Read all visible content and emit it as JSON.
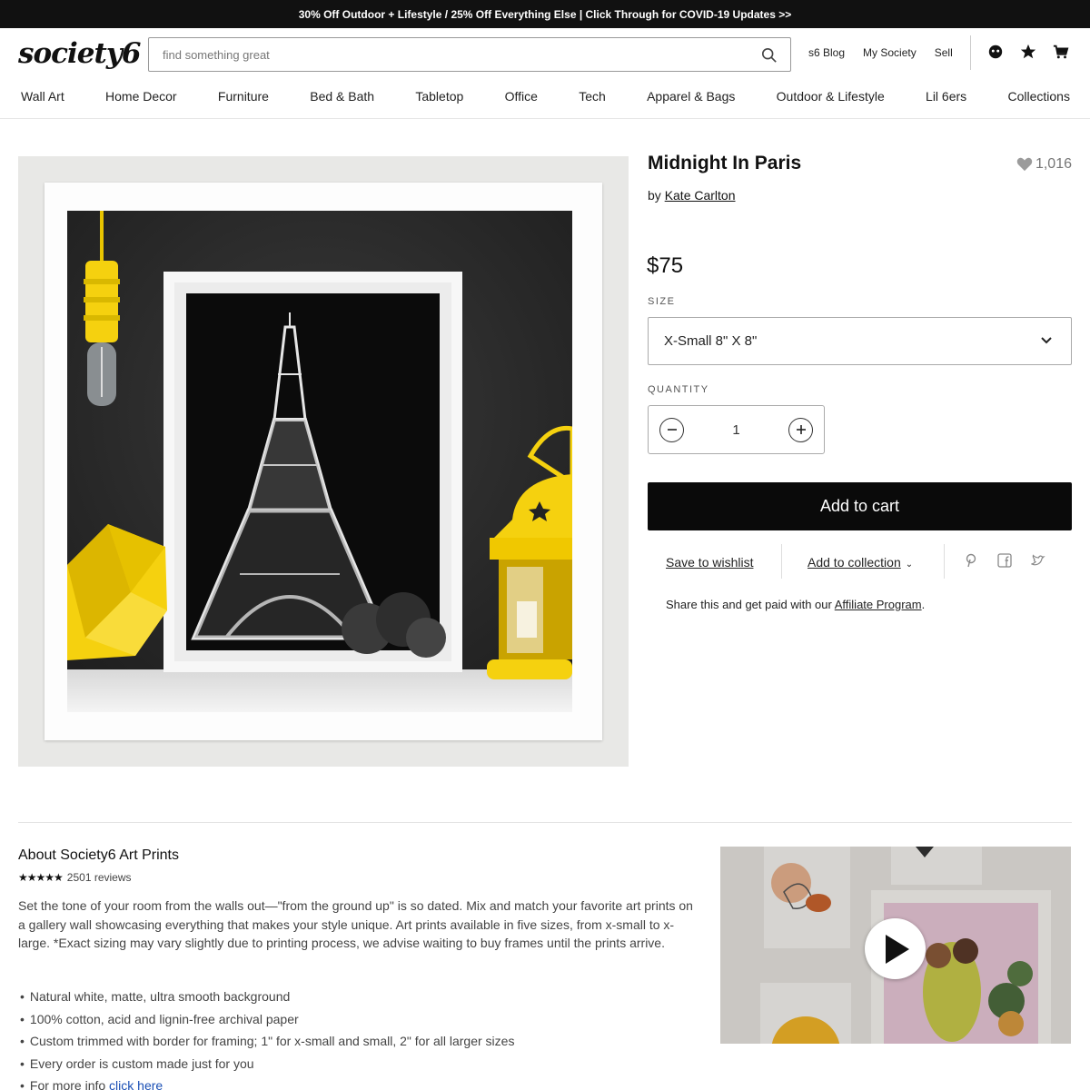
{
  "promo": {
    "text": "30% Off Outdoor + Lifestyle / 25% Off Everything Else | Click Through for COVID-19 Updates >>"
  },
  "header": {
    "logo": "society6",
    "search_placeholder": "find something great",
    "links": [
      "s6 Blog",
      "My Society",
      "Sell"
    ],
    "icons": [
      "account-icon",
      "star-icon",
      "cart-icon"
    ]
  },
  "nav": {
    "items": [
      "Wall Art",
      "Home Decor",
      "Furniture",
      "Bed & Bath",
      "Tabletop",
      "Office",
      "Tech",
      "Apparel & Bags",
      "Outdoor & Lifestyle",
      "Lil 6ers",
      "Collections"
    ]
  },
  "product": {
    "title": "Midnight In Paris",
    "likes": "1,016",
    "by_prefix": "by",
    "artist": "Kate Carlton",
    "price": "$75",
    "size_label": "SIZE",
    "size_value": "X-Small 8\" X 8\"",
    "quantity_label": "QUANTITY",
    "quantity_value": "1",
    "add_to_cart": "Add to cart",
    "save_to_wishlist": "Save to wishlist",
    "add_to_collection": "Add to collection",
    "share_icons": [
      "pinterest-icon",
      "facebook-icon",
      "twitter-icon"
    ],
    "affiliate_prefix": "Share this and get paid with our",
    "affiliate_link": "Affiliate Program",
    "affiliate_suffix": "."
  },
  "about": {
    "title": "About Society6 Art Prints",
    "stars": "★★★★★",
    "reviews": "2501 reviews",
    "description": "Set the tone of your room from the walls out—\"from the ground up\" is so dated. Mix and match your favorite art prints on a gallery wall showcasing everything that makes your style unique. Art prints available in five sizes, from x-small to x-large. *Exact sizing may vary slightly due to printing process, we advise waiting to buy frames until the prints arrive.",
    "features": [
      "Natural white, matte, ultra smooth background",
      "100% cotton, acid and lignin-free archival paper",
      "Custom trimmed with border for framing; 1\" for x-small and small, 2\" for all larger sizes",
      "Every order is custom made just for you"
    ],
    "more_info_prefix": "For more info",
    "more_info_link": "click here"
  },
  "colors": {
    "accent_yellow": "#f5d10f",
    "button_black": "#0a0a0a",
    "link_blue": "#1a4fb5"
  }
}
